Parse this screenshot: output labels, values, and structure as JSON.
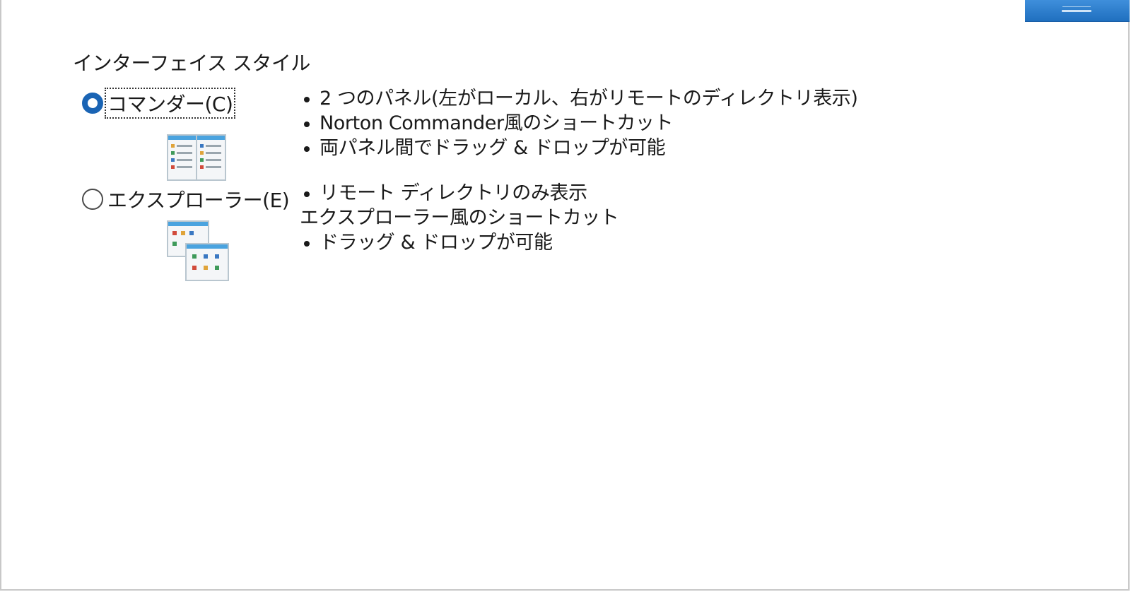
{
  "group": {
    "label": "インターフェイス スタイル"
  },
  "options": [
    {
      "label": "コマンダー(C)",
      "selected": true,
      "icon": "commander-two-panel-icon",
      "bullets": [
        "2 つのパネル(左がローカル、右がリモートのディレクトリ表示)",
        "Norton Commander風のショートカット",
        "両パネル間でドラッグ & ドロップが可能"
      ]
    },
    {
      "label": "エクスプローラー(E)",
      "selected": false,
      "icon": "explorer-windows-icon",
      "bullets": [
        "リモート ディレクトリのみ表示",
        "エクスプローラー風のショートカット",
        "ドラッグ & ドロップが可能"
      ]
    }
  ],
  "colors": {
    "accent": "#1a64b4",
    "window_button": "#2f7fcf",
    "icon_header": "#4aa3df",
    "icon_frame": "#b9c6cf"
  }
}
